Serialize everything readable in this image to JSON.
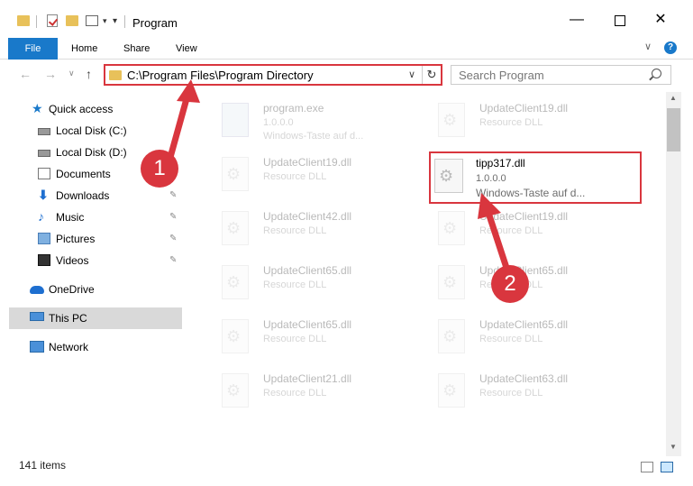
{
  "window": {
    "title": "Program",
    "minimize_glyph": "—",
    "close_glyph": "✕"
  },
  "quick_access_toolbar": {
    "customize_glyph": "▾",
    "arrow_glyph": "▾"
  },
  "ribbon": {
    "tabs": [
      {
        "label": "File"
      },
      {
        "label": "Home"
      },
      {
        "label": "Share"
      },
      {
        "label": "View"
      }
    ],
    "collapse_glyph": "∨",
    "help_glyph": "?"
  },
  "navigation": {
    "back_glyph": "←",
    "forward_glyph": "→",
    "recent_glyph": "∨",
    "up_glyph": "↑",
    "address": "C:\\Program Files\\Program Directory",
    "address_dropdown_glyph": "∨",
    "refresh_glyph": "↻",
    "search_placeholder": "Search Program"
  },
  "sidebar": {
    "items": [
      {
        "label": "Quick access",
        "icon": "star-icon"
      },
      {
        "label": "Local Disk (C:)",
        "icon": "disk-icon"
      },
      {
        "label": "Local Disk (D:)",
        "icon": "disk-icon"
      },
      {
        "label": "Documents",
        "icon": "documents-icon"
      },
      {
        "label": "Downloads",
        "icon": "download-icon"
      },
      {
        "label": "Music",
        "icon": "music-icon"
      },
      {
        "label": "Pictures",
        "icon": "pictures-icon"
      },
      {
        "label": "Videos",
        "icon": "videos-icon"
      },
      {
        "label": "OneDrive",
        "icon": "onedrive-icon"
      },
      {
        "label": "This PC",
        "icon": "pc-icon"
      },
      {
        "label": "Network",
        "icon": "network-icon"
      }
    ],
    "pin_glyph": "📌"
  },
  "files": [
    {
      "name": "program.exe",
      "version": "1.0.0.0",
      "description": "Windows-Taste auf d..."
    },
    {
      "name": "UpdateClient19.dll",
      "version": "Resource DLL",
      "description": ""
    },
    {
      "name": "UpdateClient19.dll",
      "version": "Resource DLL",
      "description": ""
    },
    {
      "name": "tipp317.dll",
      "version": "1.0.0.0",
      "description": "Windows-Taste auf d..."
    },
    {
      "name": "UpdateClient42.dll",
      "version": "Resource DLL",
      "description": ""
    },
    {
      "name": "UpdateClient19.dll",
      "version": "Resource DLL",
      "description": ""
    },
    {
      "name": "UpdateClient65.dll",
      "version": "Resource DLL",
      "description": ""
    },
    {
      "name": "UpdateClient65.dll",
      "version": "Resource DLL",
      "description": ""
    },
    {
      "name": "UpdateClient65.dll",
      "version": "Resource DLL",
      "description": ""
    },
    {
      "name": "UpdateClient65.dll",
      "version": "Resource DLL",
      "description": ""
    },
    {
      "name": "UpdateClient21.dll",
      "version": "Resource DLL",
      "description": ""
    },
    {
      "name": "UpdateClient63.dll",
      "version": "Resource DLL",
      "description": ""
    }
  ],
  "scrollbar": {
    "up_glyph": "▲",
    "down_glyph": "▼"
  },
  "status": {
    "item_count": "141 items"
  },
  "annotations": {
    "step1": "1",
    "step2": "2",
    "color": "#d9363e"
  }
}
